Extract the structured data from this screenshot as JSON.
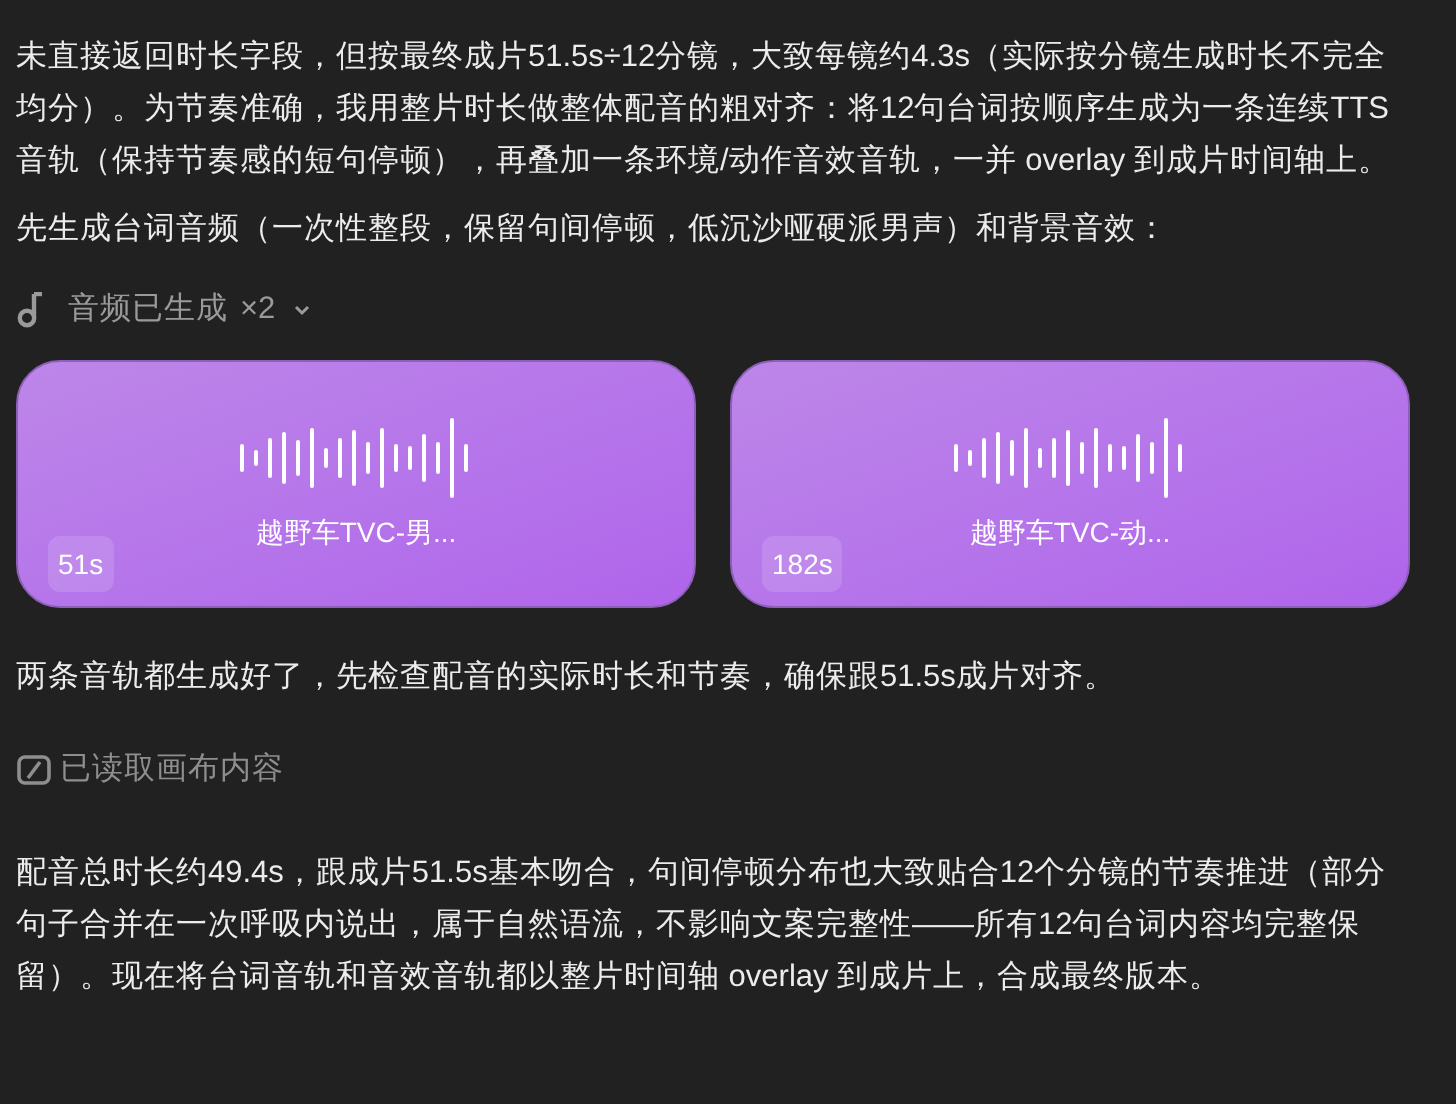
{
  "paragraphs_top": [
    "未直接返回时长字段，但按最终成片51.5s÷12分镜，大致每镜约4.3s（实际按分镜生成时长不完全均分）。为节奏准确，我用整片时长做整体配音的粗对齐：将12句台词按顺序生成为一条连续TTS音轨（保持节奏感的短句停顿），再叠加一条环境/动作音效音轨，一并 overlay 到成片时间轴上。",
    "先生成台词音频（一次性整段，保留句间停顿，低沉沙哑硬派男声）和背景音效："
  ],
  "audio_status": {
    "label": "音频已生成",
    "count": "×2",
    "expanded": false
  },
  "audio_cards": [
    {
      "title": "越野车TVC-男...",
      "duration": "51s"
    },
    {
      "title": "越野车TVC-动...",
      "duration": "182s"
    }
  ],
  "paragraph_middle": "两条音轨都生成好了，先检查配音的实际时长和节奏，确保跟51.5s成片对齐。",
  "canvas_status": {
    "label": "已读取画布内容"
  },
  "paragraph_bottom": "配音总时长约49.4s，跟成片51.5s基本吻合，句间停顿分布也大致贴合12个分镜的节奏推进（部分句子合并在一次呼吸内说出，属于自然语流，不影响文案完整性——所有12句台词内容均完整保留）。现在将台词音轨和音效音轨都以整片时间轴 overlay 到成片上，合成最终版本。"
}
